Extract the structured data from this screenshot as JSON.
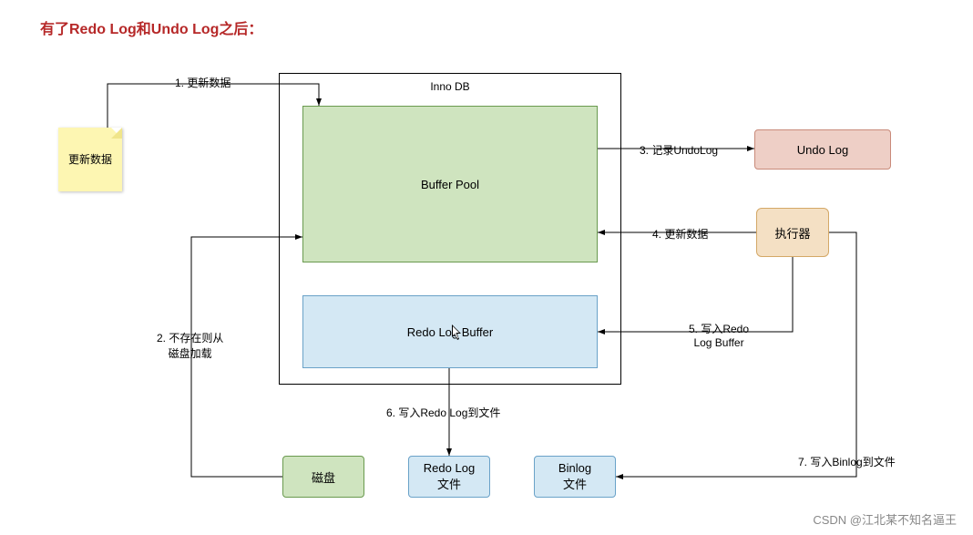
{
  "title": "有了Redo Log和Undo Log之后：",
  "boxes": {
    "innodb": "Inno DB",
    "bufferPool": "Buffer Pool",
    "redoLogBuffer": "Redo Log Buffer",
    "note": "更新数据",
    "undoLog": "Undo Log",
    "executor": "执行器",
    "disk": "磁盘",
    "redoLogFile": "Redo Log\n文件",
    "binlogFile": "Binlog\n文件"
  },
  "edges": {
    "e1": "1. 更新数据",
    "e2": "2. 不存在则从\n磁盘加载",
    "e3": "3. 记录UndoLog",
    "e4": "4. 更新数据",
    "e5": "5. 写入Redo\nLog Buffer",
    "e6": "6. 写入Redo Log到文件",
    "e7": "7. 写入Binlog到文件"
  },
  "watermark": "CSDN @江北某不知名逼王"
}
